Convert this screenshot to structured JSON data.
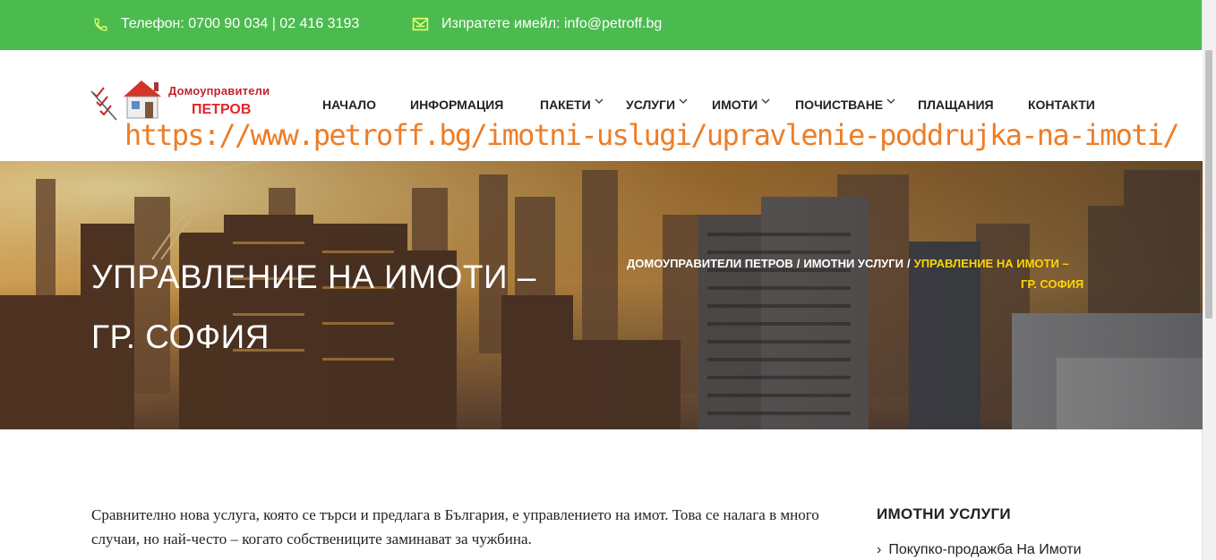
{
  "topbar": {
    "phone_text": "Телефон: 0700 90 034 | 02 416 3193",
    "email_text": "Изпратете имейл: info@petroff.bg",
    "bg_color": "#4cbb4f"
  },
  "logo": {
    "line1": "Домоуправители",
    "line2": "ПЕТРОВ"
  },
  "nav": {
    "items": [
      {
        "label": "НАЧАЛО"
      },
      {
        "label": "ИНФОРМАЦИЯ"
      },
      {
        "label": "ПАКЕТИ"
      },
      {
        "label": "УСЛУГИ"
      },
      {
        "label": "ИМОТИ"
      },
      {
        "label": "ПОЧИСТВАНЕ"
      },
      {
        "label": "ПЛАЩАНИЯ"
      },
      {
        "label": "КОНТАКТИ"
      }
    ]
  },
  "overlay_url": "https://www.petroff.bg/imotni-uslugi/upravlenie-poddrujka-na-imoti/",
  "hero": {
    "title_line1": "УПРАВЛЕНИЕ НА ИМОТИ –",
    "title_line2": "ГР. СОФИЯ",
    "breadcrumb": {
      "home": "ДОМОУПРАВИТЕЛИ ПЕТРОВ",
      "sep": "/",
      "section": "ИМОТНИ УСЛУГИ",
      "current_line1": "УПРАВЛЕНИЕ НА ИМОТИ –",
      "current_line2": "ГР. СОФИЯ"
    }
  },
  "content": {
    "paragraph": "Сравнително нова услуга, която се търси и предлага в България, е управлението на имот. Това се налага в много случаи, но най-често – когато собствениците заминават за чужбина."
  },
  "sidebar": {
    "title": "ИМОТНИ УСЛУГИ",
    "items": [
      {
        "label": "Покупко-продажба На Имоти"
      }
    ]
  }
}
